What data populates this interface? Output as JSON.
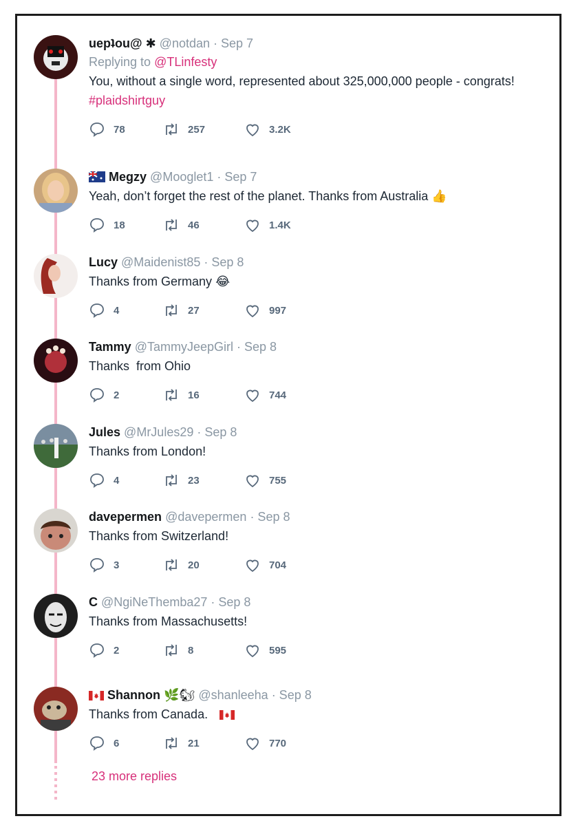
{
  "tweets": [
    {
      "name": "uepʇou@",
      "badge": "✱",
      "handle": "@notdan",
      "date": "· Sep 7",
      "replying_prefix": "Replying to",
      "replying_to": "@TLinfesty",
      "text": "You, without a single word, represented about 325,000,000 people - congrats!",
      "hashtag": "#plaidshirtguy",
      "replies": "78",
      "retweets": "257",
      "likes": "3.2K"
    },
    {
      "name": "Megzy",
      "handle": "@Mooglet1",
      "date": "· Sep 7",
      "text": "Yeah, don’t forget the rest of the planet. Thanks from Australia",
      "emoji": "👍",
      "replies": "18",
      "retweets": "46",
      "likes": "1.4K"
    },
    {
      "name": "Lucy",
      "handle": "@Maidenist85",
      "date": "· Sep 8",
      "text": "Thanks from Germany",
      "emoji": "😂",
      "replies": "4",
      "retweets": "27",
      "likes": "997"
    },
    {
      "name": "Tammy",
      "handle": "@TammyJeepGirl",
      "date": "· Sep 8",
      "text": "Thanks  from Ohio",
      "replies": "2",
      "retweets": "16",
      "likes": "744"
    },
    {
      "name": "Jules",
      "handle": "@MrJules29",
      "date": "· Sep 8",
      "text": "Thanks from London!",
      "replies": "4",
      "retweets": "23",
      "likes": "755"
    },
    {
      "name": "davepermen",
      "handle": "@davepermen",
      "date": "· Sep 8",
      "text": "Thanks from Switzerland!",
      "replies": "3",
      "retweets": "20",
      "likes": "704"
    },
    {
      "name": "C",
      "handle": "@NgiNeThemba27",
      "date": "· Sep 8",
      "text": "Thanks from Massachusetts!",
      "replies": "2",
      "retweets": "8",
      "likes": "595"
    },
    {
      "name": "Shannon",
      "name_emoji": "🌿🐿",
      "handle": "@shanleeha",
      "date": "· Sep 8",
      "text": "Thanks from Canada.",
      "replies": "6",
      "retweets": "21",
      "likes": "770"
    }
  ],
  "more_replies": "23 more replies",
  "colors": {
    "accent": "#d7307a",
    "thread_line": "#f4b6c9",
    "muted": "#8a97a3"
  }
}
